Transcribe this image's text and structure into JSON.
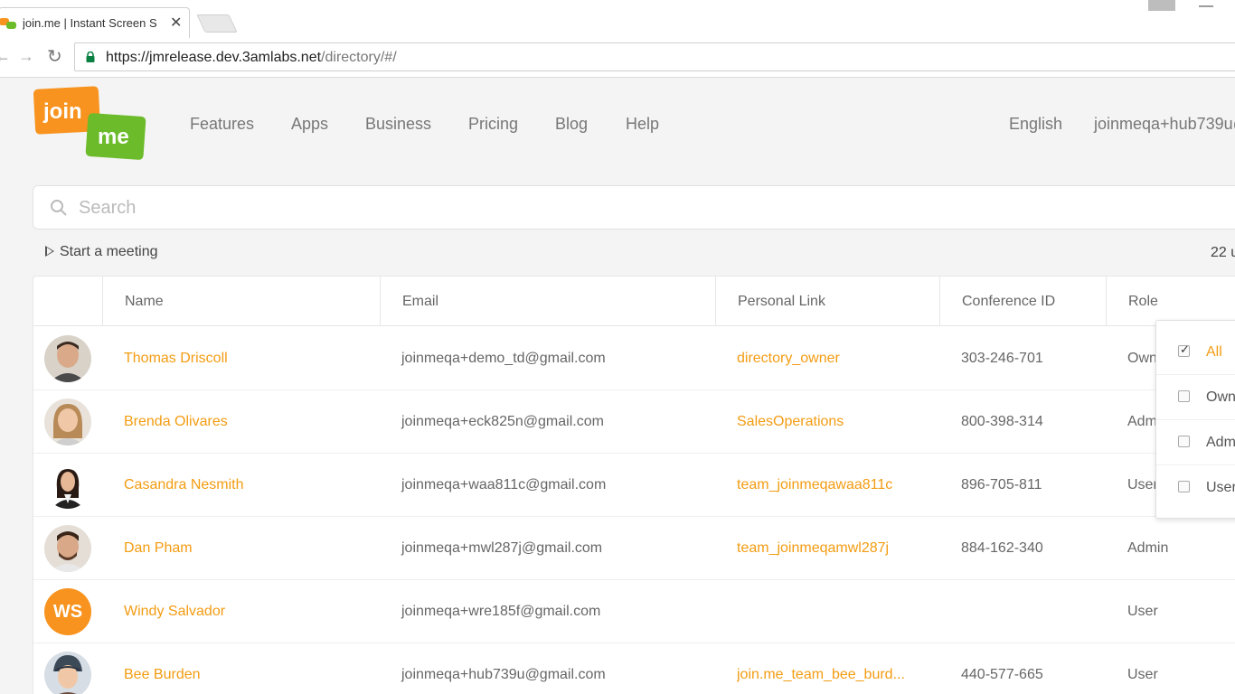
{
  "browser": {
    "tab_title": "join.me | Instant Screen S",
    "close_glyph": "✕",
    "url_host": "https://jmrelease.dev.3amlabs.net",
    "url_path": "/directory/#/",
    "back_glyph": "←",
    "forward_glyph": "→",
    "reload_glyph": "↻",
    "minimize_glyph": "—"
  },
  "header": {
    "logo_text_top": "join",
    "logo_text_bottom": "me",
    "nav": [
      {
        "label": "Features"
      },
      {
        "label": "Apps"
      },
      {
        "label": "Business"
      },
      {
        "label": "Pricing"
      },
      {
        "label": "Blog"
      },
      {
        "label": "Help"
      }
    ],
    "language": "English",
    "account": "joinmeqa+hub739u@"
  },
  "search": {
    "placeholder": "Search"
  },
  "actions": {
    "start_meeting": "Start a meeting",
    "count": "22 u"
  },
  "table": {
    "columns": [
      {
        "label": "Name"
      },
      {
        "label": "Email"
      },
      {
        "label": "Personal Link"
      },
      {
        "label": "Conference ID"
      },
      {
        "label": "Role"
      }
    ],
    "rows": [
      {
        "name": "Thomas Driscoll",
        "email": "joinmeqa+demo_td@gmail.com",
        "link": "directory_owner",
        "conference_id": "303-246-701",
        "role": "Own",
        "avatar": "photo",
        "initials": ""
      },
      {
        "name": "Brenda Olivares",
        "email": "joinmeqa+eck825n@gmail.com",
        "link": "SalesOperations",
        "conference_id": "800-398-314",
        "role": "Adm",
        "avatar": "photo",
        "initials": ""
      },
      {
        "name": "Casandra Nesmith",
        "email": "joinmeqa+waa811c@gmail.com",
        "link": "team_joinmeqawaa811c",
        "conference_id": "896-705-811",
        "role": "User",
        "avatar": "photo",
        "initials": ""
      },
      {
        "name": "Dan Pham",
        "email": "joinmeqa+mwl287j@gmail.com",
        "link": "team_joinmeqamwl287j",
        "conference_id": "884-162-340",
        "role": "Admin",
        "avatar": "photo",
        "initials": ""
      },
      {
        "name": "Windy Salvador",
        "email": "joinmeqa+wre185f@gmail.com",
        "link": "",
        "conference_id": "",
        "role": "User",
        "avatar": "initials",
        "initials": "WS"
      },
      {
        "name": "Bee Burden",
        "email": "joinmeqa+hub739u@gmail.com",
        "link": "join.me_team_bee_burd...",
        "conference_id": "440-577-665",
        "role": "User",
        "avatar": "photo",
        "initials": ""
      }
    ]
  },
  "role_filter": {
    "options": [
      {
        "label": "All",
        "checked": true
      },
      {
        "label": "Own",
        "checked": false
      },
      {
        "label": "Adm",
        "checked": false
      },
      {
        "label": "User",
        "checked": false
      }
    ]
  },
  "colors": {
    "accent_orange": "#f39c12",
    "logo_orange": "#f7931e",
    "logo_green": "#6cbb2a"
  }
}
